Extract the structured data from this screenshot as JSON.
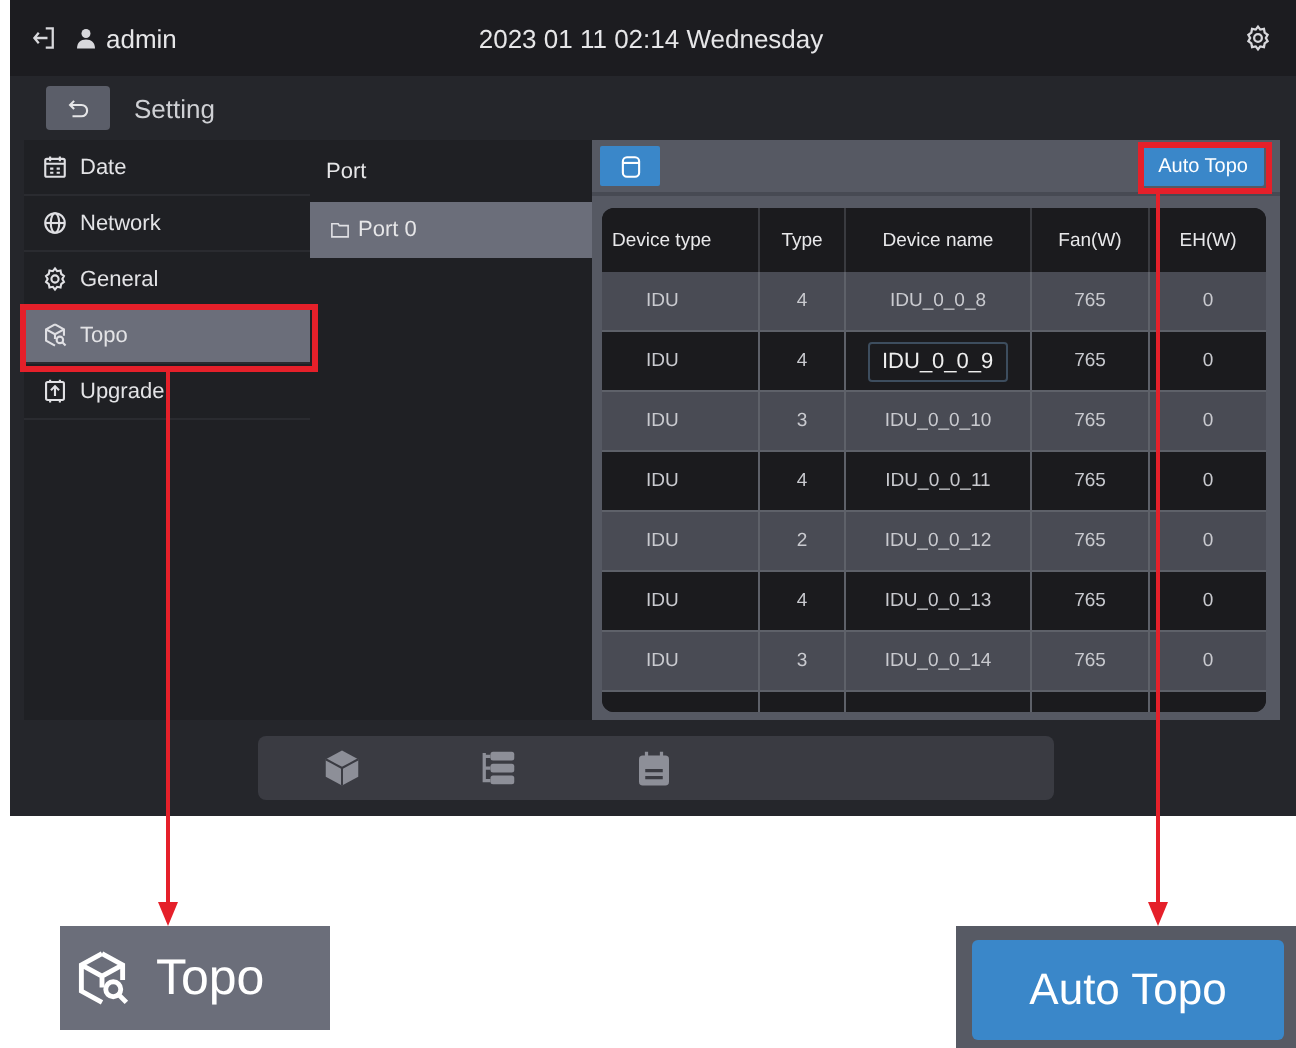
{
  "header": {
    "user": "admin",
    "datetime": "2023 01 11 02:14 Wednesday"
  },
  "page": {
    "title": "Setting"
  },
  "menu": [
    {
      "label": "Date",
      "kind": "calendar",
      "selected": false,
      "highlighted": false
    },
    {
      "label": "Network",
      "kind": "globe",
      "selected": false,
      "highlighted": false
    },
    {
      "label": "General",
      "kind": "gear",
      "selected": false,
      "highlighted": false
    },
    {
      "label": "Topo",
      "kind": "topo",
      "selected": true,
      "highlighted": true
    },
    {
      "label": "Upgrade",
      "kind": "upgrade",
      "selected": false,
      "highlighted": false
    }
  ],
  "ports": {
    "heading": "Port",
    "items": [
      {
        "label": "Port 0",
        "selected": true
      }
    ]
  },
  "table": {
    "button": {
      "label": "Auto Topo",
      "highlighted": true
    },
    "columns": [
      "Device type",
      "Type",
      "Device name",
      "Fan(W)",
      "EH(W)"
    ],
    "rows": [
      {
        "cells": [
          "IDU",
          "4",
          "IDU_0_0_8",
          "765",
          "0"
        ],
        "editing": false
      },
      {
        "cells": [
          "IDU",
          "4",
          "IDU_0_0_9",
          "765",
          "0"
        ],
        "editing": true
      },
      {
        "cells": [
          "IDU",
          "3",
          "IDU_0_0_10",
          "765",
          "0"
        ],
        "editing": false
      },
      {
        "cells": [
          "IDU",
          "4",
          "IDU_0_0_11",
          "765",
          "0"
        ],
        "editing": false
      },
      {
        "cells": [
          "IDU",
          "2",
          "IDU_0_0_12",
          "765",
          "0"
        ],
        "editing": false
      },
      {
        "cells": [
          "IDU",
          "4",
          "IDU_0_0_13",
          "765",
          "0"
        ],
        "editing": false
      },
      {
        "cells": [
          "IDU",
          "3",
          "IDU_0_0_14",
          "765",
          "0"
        ],
        "editing": false
      }
    ]
  },
  "dock": [
    {
      "kind": "cube"
    },
    {
      "kind": "list"
    },
    {
      "kind": "calendar"
    }
  ],
  "callouts": [
    {
      "kind": "menu",
      "label": "Topo"
    },
    {
      "kind": "button",
      "label": "Auto Topo"
    }
  ]
}
